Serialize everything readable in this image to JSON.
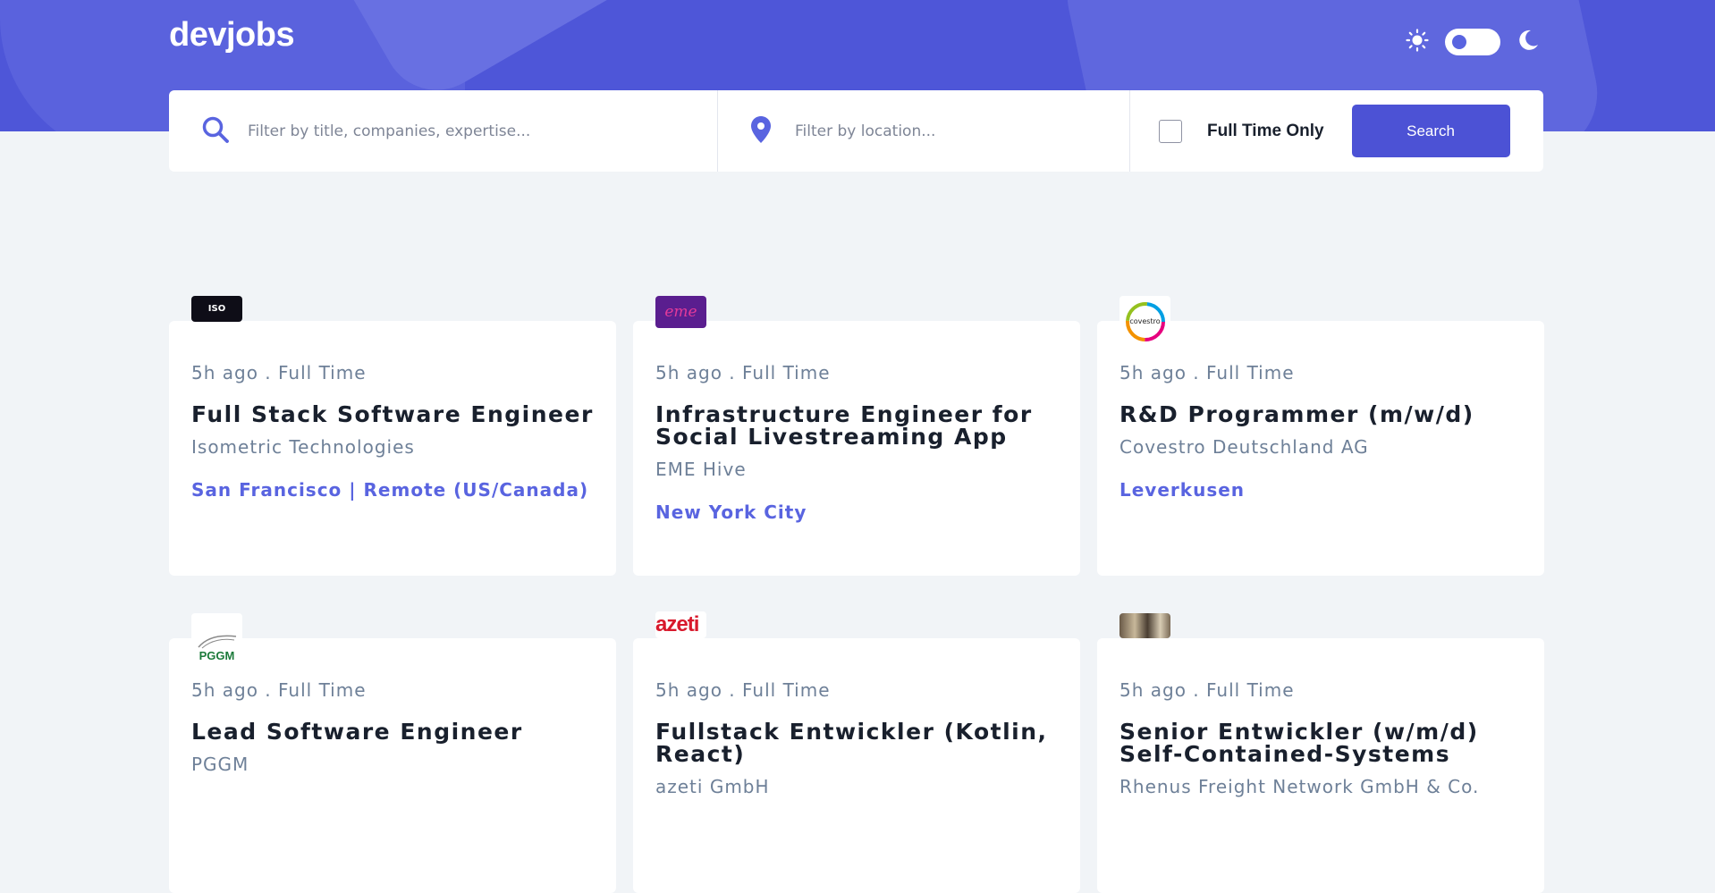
{
  "app": {
    "brand": "devjobs"
  },
  "theme_toggle": {
    "mode": "light"
  },
  "search": {
    "title_placeholder": "Filter by title, companies, expertise...",
    "location_placeholder": "Filter by location...",
    "fulltime_label": "Full Time Only",
    "search_button": "Search"
  },
  "jobs": [
    {
      "meta": "5h ago . Full Time",
      "title": "Full Stack Software Engineer",
      "company": "Isometric Technologies",
      "location": "San Francisco | Remote (US/Canada)",
      "logo_text": "ISO",
      "logo_bg": "#0e0d17"
    },
    {
      "meta": "5h ago . Full Time",
      "title": "Infrastructure Engineer for Social Livestreaming App",
      "company": "EME Hive",
      "location": "New York City",
      "logo_text": "eme",
      "logo_bg": "#5a1e8f"
    },
    {
      "meta": "5h ago . Full Time",
      "title": "R&D Programmer (m/w/d)",
      "company": "Covestro Deutschland AG",
      "location": "Leverkusen",
      "logo_text": "covestro",
      "logo_bg": "#ffffff"
    },
    {
      "meta": "5h ago . Full Time",
      "title": "Lead Software Engineer",
      "company": "PGGM",
      "location": "",
      "logo_text": "PGGM",
      "logo_bg": "#ffffff"
    },
    {
      "meta": "5h ago . Full Time",
      "title": "Fullstack Entwickler (Kotlin, React)",
      "company": "azeti GmbH",
      "location": "",
      "logo_text": "azeti",
      "logo_bg": "#ffffff"
    },
    {
      "meta": "5h ago . Full Time",
      "title": "Senior Entwickler (w/m/d) Self-Contained-Systems",
      "company": "Rhenus Freight Network GmbH & Co.",
      "location": "",
      "logo_text": "",
      "logo_bg": "#8a7a64"
    }
  ],
  "colors": {
    "accent": "#5964e0",
    "header_bg": "#4e56d8",
    "page_bg": "#f1f4f7",
    "text_dark": "#19202d",
    "text_muted": "#6e8098"
  }
}
